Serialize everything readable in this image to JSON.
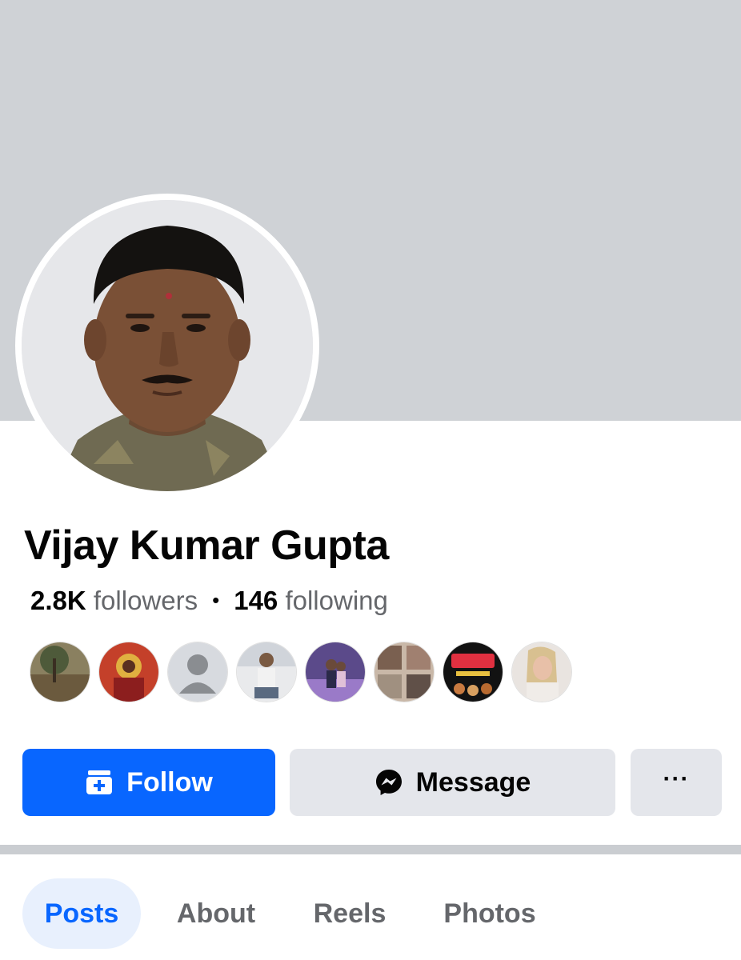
{
  "profile": {
    "name": "Vijay Kumar Gupta",
    "followers_count": "2.8K",
    "followers_label": "followers",
    "separator": "•",
    "following_count": "146",
    "following_label": "following"
  },
  "mutual_friends": [
    {
      "name": "friend-1"
    },
    {
      "name": "friend-2"
    },
    {
      "name": "friend-3"
    },
    {
      "name": "friend-4"
    },
    {
      "name": "friend-5"
    },
    {
      "name": "friend-6"
    },
    {
      "name": "friend-7"
    },
    {
      "name": "friend-8"
    }
  ],
  "actions": {
    "follow_label": "Follow",
    "message_label": "Message",
    "more_label": "···"
  },
  "tabs": [
    {
      "label": "Posts",
      "active": true
    },
    {
      "label": "About",
      "active": false
    },
    {
      "label": "Reels",
      "active": false
    },
    {
      "label": "Photos",
      "active": false
    }
  ],
  "colors": {
    "accent": "#0866ff",
    "cover": "#cfd2d6",
    "button_secondary": "#e4e6eb",
    "tab_active_bg": "#e8f0fd"
  },
  "icons": {
    "follow": "follow-plus-icon",
    "message": "messenger-icon",
    "more": "more-dots-icon"
  }
}
